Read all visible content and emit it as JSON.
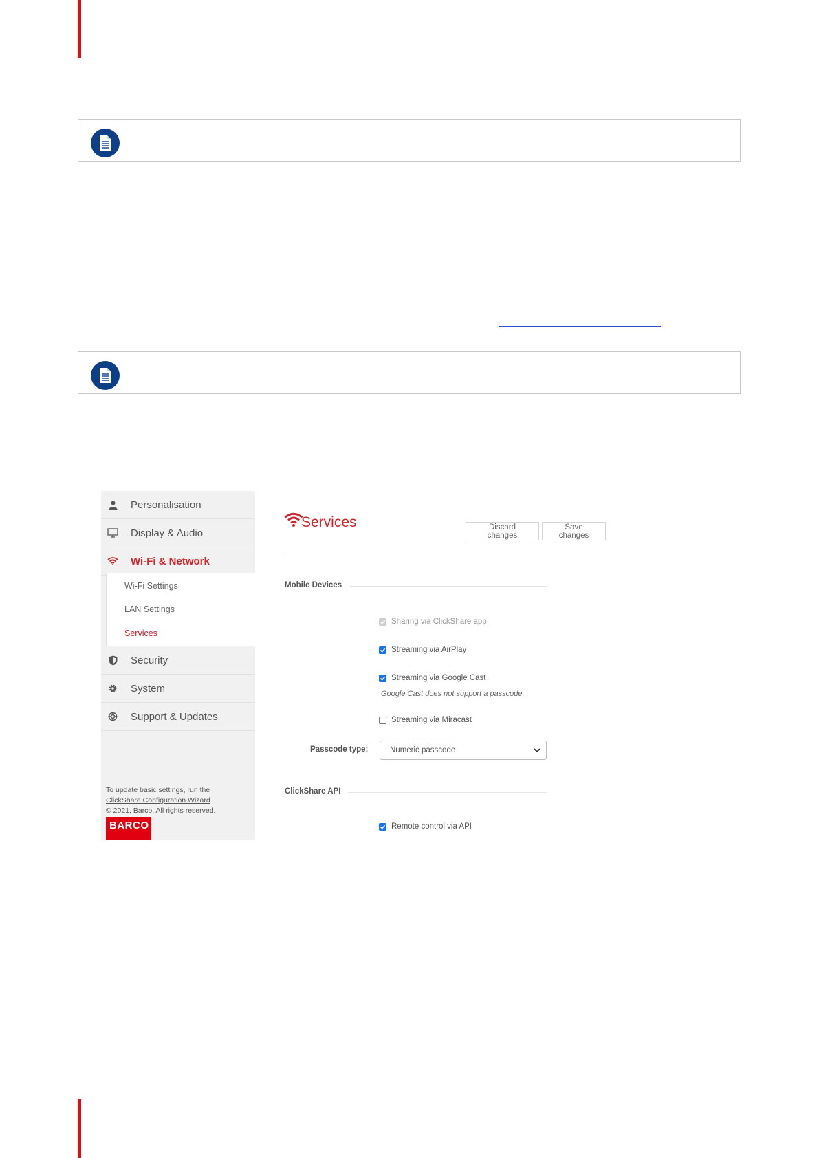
{
  "colors": {
    "accent_red": "#d8101a",
    "note_icon_blue": "#0c3f86",
    "checkbox_blue": "#1a73e8",
    "barco_red": "#e1000f"
  },
  "sidebar": {
    "items": [
      {
        "label": "Personalisation",
        "icon": "person-icon"
      },
      {
        "label": "Display & Audio",
        "icon": "monitor-icon"
      },
      {
        "label": "Wi-Fi & Network",
        "icon": "wifi-icon",
        "active": true
      },
      {
        "label": "Security",
        "icon": "shield-icon"
      },
      {
        "label": "System",
        "icon": "gear-icon"
      },
      {
        "label": "Support & Updates",
        "icon": "lifebuoy-icon"
      }
    ],
    "subitems": [
      {
        "label": "Wi-Fi Settings"
      },
      {
        "label": "LAN Settings"
      },
      {
        "label": "Services",
        "active": true
      }
    ],
    "footer": {
      "line1": "To update basic settings, run the",
      "wizard_link": "ClickShare Configuration Wizard",
      "copyright": "© 2021, Barco. All rights reserved."
    },
    "logo_text": "BARCO"
  },
  "main": {
    "title": "Services",
    "discard_label": "Discard changes",
    "save_label": "Save changes",
    "mobile_section": "Mobile Devices",
    "options": [
      {
        "label": "Sharing via ClickShare app",
        "state": "disabled-checked"
      },
      {
        "label": "Streaming via AirPlay",
        "state": "checked"
      },
      {
        "label": "Streaming via Google Cast",
        "state": "checked"
      },
      {
        "label": "Streaming via Miracast",
        "state": "unchecked"
      }
    ],
    "google_cast_hint": "Google Cast does not support a passcode.",
    "passcode_label": "Passcode type:",
    "passcode_value": "Numeric passcode",
    "api_section": "ClickShare API",
    "api_option": {
      "label": "Remote control via API",
      "state": "checked"
    }
  }
}
